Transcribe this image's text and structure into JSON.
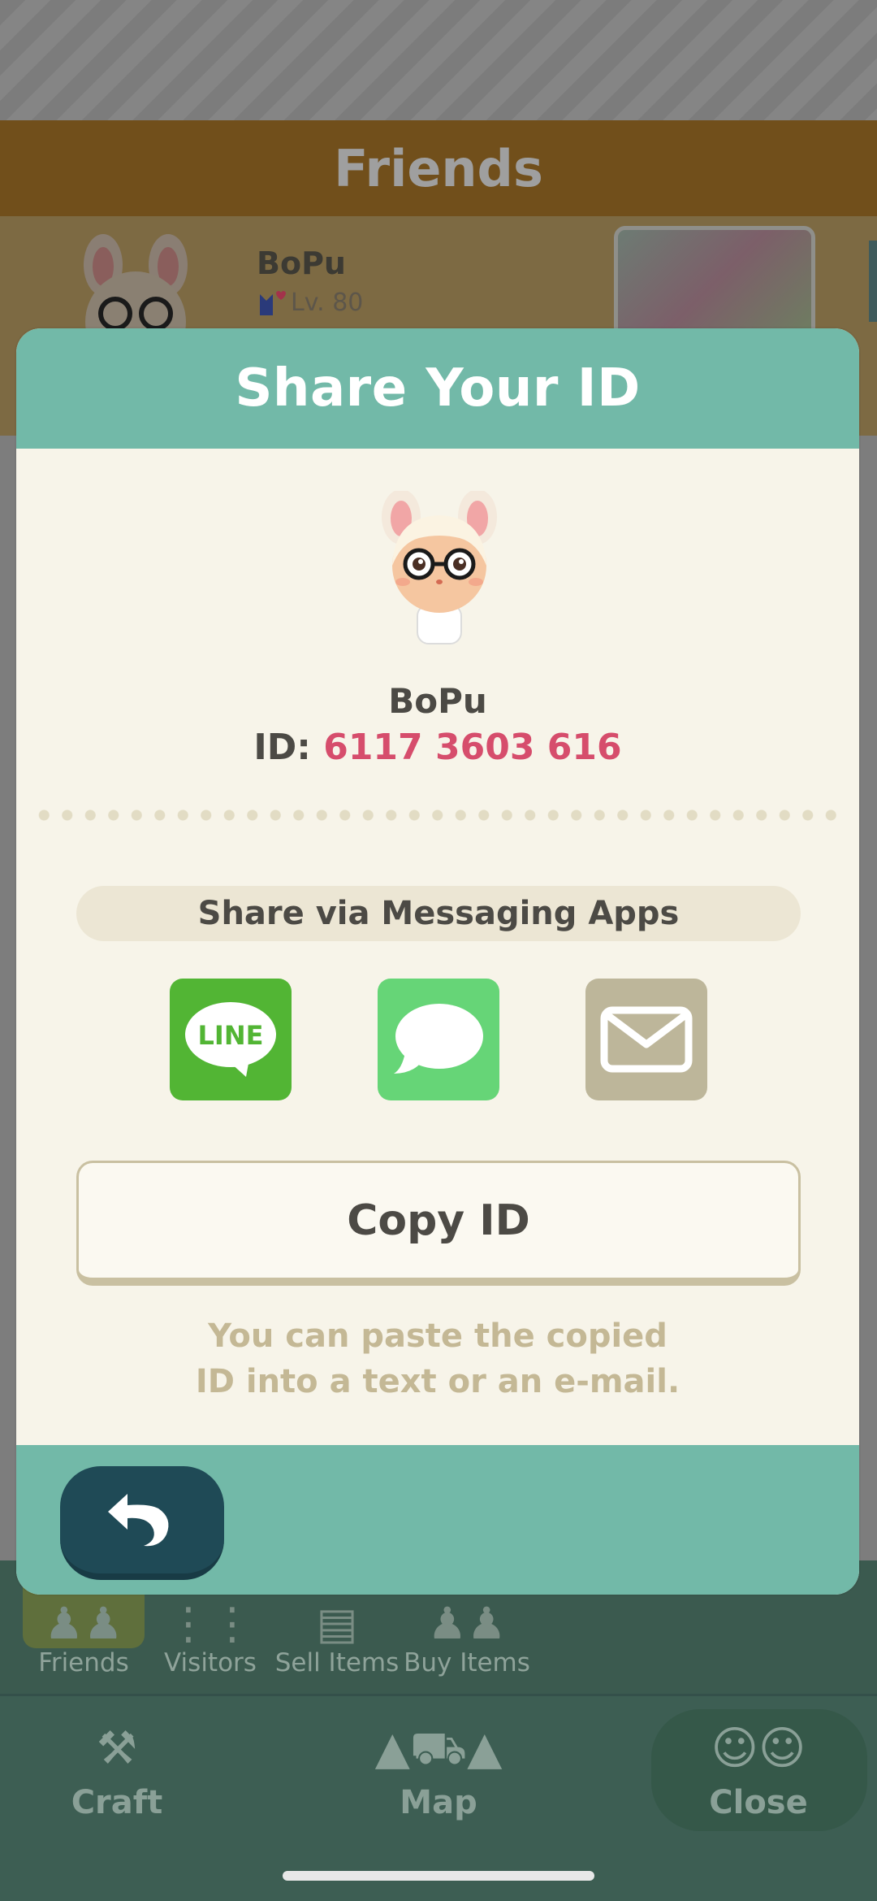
{
  "background": {
    "header_title": "Friends",
    "friend": {
      "name": "BoPu",
      "level": "Lv. 80"
    },
    "tabs": [
      {
        "label": "Friends",
        "icon": "friends-icon"
      },
      {
        "label": "Visitors",
        "icon": "footprints-icon"
      },
      {
        "label": "Sell Items",
        "icon": "sell-box-icon"
      },
      {
        "label": "Buy Items",
        "icon": "buy-people-icon"
      }
    ],
    "nav": {
      "craft": "Craft",
      "map": "Map",
      "close": "Close"
    }
  },
  "modal": {
    "title": "Share Your ID",
    "player_name": "BoPu",
    "id_label": "ID:",
    "id_value": "6117 3603 616",
    "share_label": "Share via Messaging Apps",
    "line_text": "LINE",
    "share_buttons": [
      "line-icon",
      "messages-icon",
      "mail-icon"
    ],
    "copy_label": "Copy ID",
    "hint_line1": "You can paste the copied",
    "hint_line2": "ID into a text or an e-mail."
  },
  "colors": {
    "header_teal": "#72b9a8",
    "id_red": "#d64d6c",
    "line_green": "#52b534",
    "messages_green": "#66d577",
    "mail_tan": "#bdb69a",
    "back_button": "#1f4a56"
  }
}
